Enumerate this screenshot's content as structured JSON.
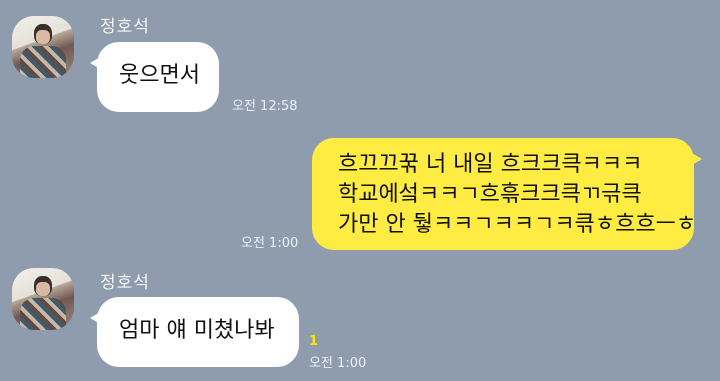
{
  "chat": {
    "messages": [
      {
        "sender": "정호석",
        "avatar": "profile-photo",
        "text": "웃으면서",
        "time": "오전 12:58"
      },
      {
        "sender": "me",
        "lines": [
          "흐끄끄꾺 너 내일 흐크크큭ㅋㅋㅋ",
          "학교에섴ㅋㅋㄱ흐흒크크큭ㄲ귺큭",
          "가만 안 뒇ㅋㅋㄱㅋㅋㄱㅋ큮ㅎ흐흐ㅡㅎ"
        ],
        "time": "오전 1:00"
      },
      {
        "sender": "정호석",
        "avatar": "profile-photo",
        "text": "엄마 얘 미쳤나봐",
        "time": "오전 1:00",
        "unread": "1"
      }
    ]
  },
  "colors": {
    "background": "#8e9cae",
    "incoming_bubble": "#ffffff",
    "outgoing_bubble": "#ffec42",
    "unread": "#ffe600"
  }
}
